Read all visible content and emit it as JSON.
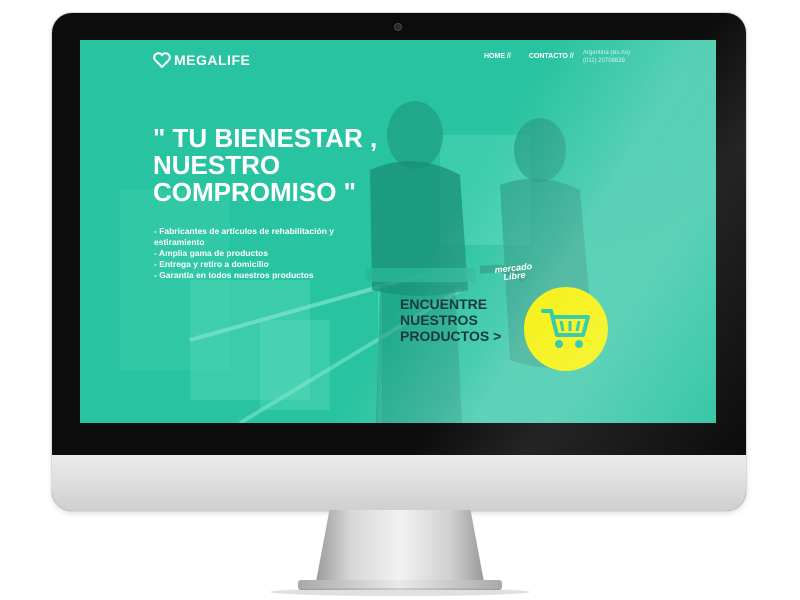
{
  "site": {
    "logo_text": "MEGALIFE",
    "brand_color": "#2cc9a6",
    "accent_color": "#f5f21b"
  },
  "nav": {
    "items": [
      {
        "label": "HOME //"
      },
      {
        "label": "CONTACTO //"
      }
    ]
  },
  "contact": {
    "location": "Argentina (Bs.As)",
    "phone": "(011) 20708639"
  },
  "hero": {
    "headline_line1": "\" TU BIENESTAR ,",
    "headline_line2": "NUESTRO",
    "headline_line3": "COMPROMISO \"",
    "features": [
      "- Fabricantes de artículos de rehabilitación y estiramiento",
      "- Amplia gama de productos",
      "- Entrega y retiro a domicilio",
      "- Garantía en todos nuestros productos"
    ],
    "marketplace_line1": "mercado",
    "marketplace_line2": "Libre",
    "cta_line1": "ENCUENTRE",
    "cta_line2": "NUESTROS",
    "cta_line3": "PRODUCTOS >",
    "cart_icon": "shopping-cart-icon"
  }
}
